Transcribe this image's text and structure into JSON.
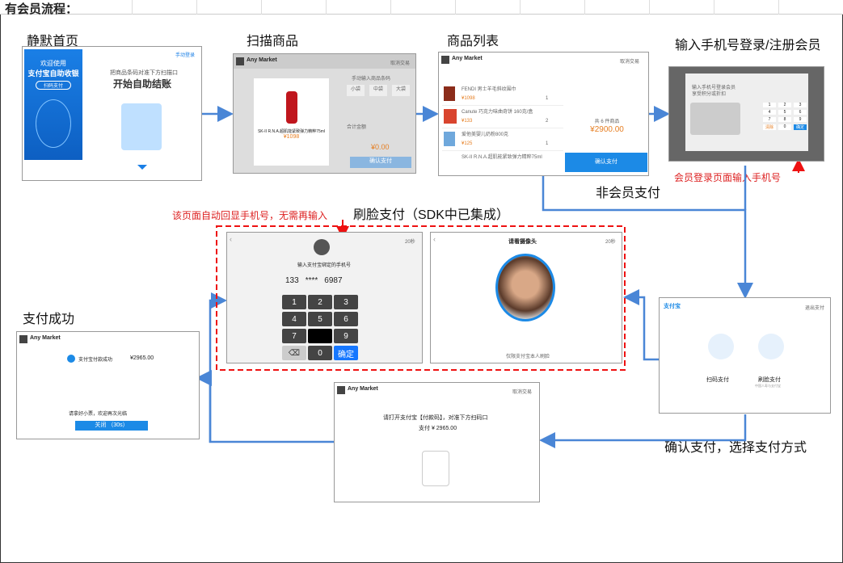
{
  "header": {
    "title": "有会员流程："
  },
  "steps": {
    "idle": "静默首页",
    "scan": "扫描商品",
    "list": "商品列表",
    "login": "输入手机号登录/注册会员",
    "face": "刷脸支付（SDK中已集成）",
    "success": "支付成功",
    "confirm": "确认支付，选择支付方式",
    "non_member": "非会员支付"
  },
  "notes": {
    "auto_phone": "该页面自动回显手机号，无需再输入",
    "member_login": "会员登录页面输入手机号"
  },
  "idle_screen": {
    "welcome": "欢迎使用",
    "brand": "支付宝自助收银",
    "sub": "扫码支付",
    "prompt": "把商品条码对准下方扫描口",
    "start": "开始自助结账",
    "corner": "手动登录"
  },
  "scan_screen": {
    "store": "Any Market",
    "cancel": "取消交易",
    "product": "SK-II R.N.A.超肌能紧致弹力精粹75ml",
    "price": "¥1098",
    "bag_label": "手动输入商品条码",
    "bags": [
      "小袋",
      "中袋",
      "大袋"
    ],
    "total_label": "合计金额",
    "total_value": "¥0.00",
    "pay": "确认支付"
  },
  "list_screen": {
    "store": "Any Market",
    "cancel": "取消交易",
    "items": [
      {
        "name": "FENDI 男士羊毛斜纹围巾",
        "price": "¥1098",
        "qty": "1"
      },
      {
        "name": "Canute 巧克力味曲奇饼 160克/盒",
        "price": "¥133",
        "qty": "2"
      },
      {
        "name": "爱他美婴儿奶粉800克",
        "price": "¥125",
        "qty": "1"
      },
      {
        "name": "SK-II R.N.A.超肌能紧致弹力精粹75ml",
        "price": "",
        "qty": ""
      }
    ],
    "total_label": "共 6 件商品",
    "total": "¥2900.00",
    "pay": "确认支付"
  },
  "login_screen": {
    "title": "输入手机号登录会员",
    "sub": "享受积分或折扣",
    "keys": [
      "1",
      "2",
      "3",
      "4",
      "5",
      "6",
      "7",
      "8",
      "9",
      "清除",
      "0",
      "确定"
    ]
  },
  "face_phone": {
    "title": "输入支付宝绑定的手机号",
    "timer": "20秒",
    "phone": [
      "133",
      "****",
      "6987"
    ],
    "keys": [
      "1",
      "2",
      "3",
      "4",
      "5",
      "6",
      "7",
      "",
      "9",
      "⌫",
      "0",
      "确定"
    ]
  },
  "face_camera": {
    "title": "请看摄像头",
    "timer": "20秒",
    "foot": "仅限支付宝本人刷脸",
    "note": ""
  },
  "success_screen": {
    "store": "Any Market",
    "msg": "支付宝付款成功",
    "amount": "¥2965.00",
    "thanks": "请拿好小票，欢迎再次光临",
    "close": "关闭 （30s）"
  },
  "method_screen": {
    "brand": "支付宝",
    "exit": "退出支付",
    "options": [
      "扫码支付",
      "刷脸支付"
    ],
    "face_sub": "中国人寿与支付宝"
  },
  "qr_screen": {
    "store": "Any Market",
    "cancel": "取消交易",
    "line1": "请打开支付宝【付款码】，对准下方扫码口",
    "line2": "支付 ¥ 2965.00"
  }
}
